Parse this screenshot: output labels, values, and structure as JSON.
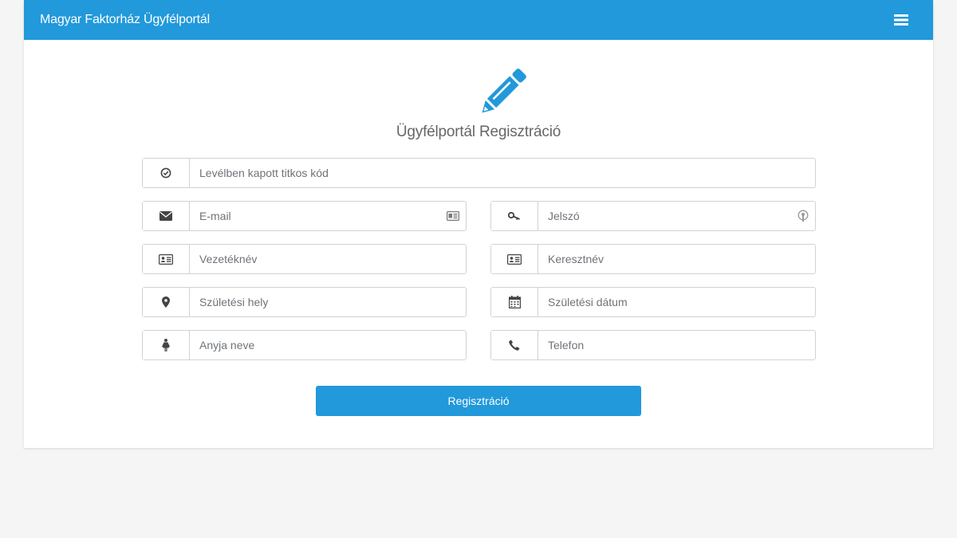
{
  "navbar": {
    "brand": "Magyar Faktorház Ügyfélportál",
    "menu_icon": "hamburger-icon"
  },
  "form": {
    "header_icon": "pencil-icon",
    "title": "Ügyfélportál Regisztráció",
    "fields": {
      "secret_code": {
        "placeholder": "Levélben kapott titkos kód",
        "icon": "check-circle-icon"
      },
      "email": {
        "placeholder": "E-mail",
        "icon": "envelope-icon",
        "inner_icon": "contact-card-icon"
      },
      "password": {
        "placeholder": "Jelszó",
        "icon": "key-icon",
        "inner_icon": "password-manager-icon"
      },
      "last_name": {
        "placeholder": "Vezetéknév",
        "icon": "id-card-icon"
      },
      "first_name": {
        "placeholder": "Keresztnév",
        "icon": "id-card-icon"
      },
      "birth_place": {
        "placeholder": "Születési hely",
        "icon": "map-marker-icon"
      },
      "birth_date": {
        "placeholder": "Születési dátum",
        "icon": "calendar-icon"
      },
      "mother_name": {
        "placeholder": "Anyja neve",
        "icon": "female-icon"
      },
      "phone": {
        "placeholder": "Telefon",
        "icon": "phone-icon"
      }
    },
    "submit_label": "Regisztráció"
  },
  "colors": {
    "accent": "#2199db",
    "background": "#f5f5f5",
    "card": "#ffffff",
    "icon": "#555555"
  }
}
